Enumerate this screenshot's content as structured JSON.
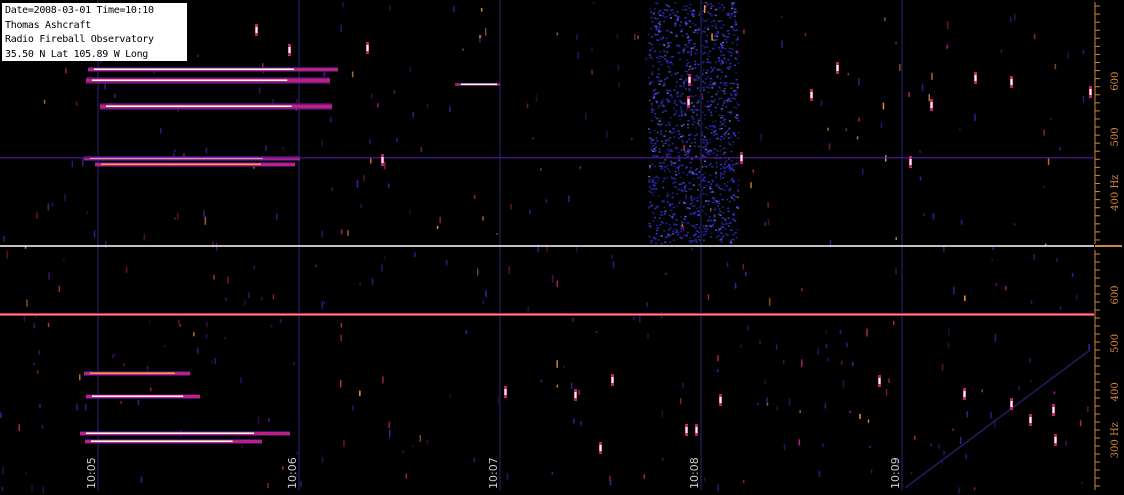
{
  "info": {
    "line1": "Date=2008-03-01 Time=10:10",
    "line2": "Thomas Ashcraft",
    "line3": "Radio Fireball Observatory",
    "line4": "35.50 N Lat  105.89 W Long"
  },
  "time_axis": {
    "labels": [
      "10:05",
      "10:06",
      "10:07",
      "10:08",
      "10:09"
    ]
  },
  "top_panel": {
    "freq_labels": [
      "600",
      "500",
      "400 Hz"
    ],
    "freq_values": [
      600,
      500,
      400
    ]
  },
  "bottom_panel": {
    "freq_labels": [
      "600",
      "500",
      "400",
      "300 Hz"
    ],
    "freq_values": [
      600,
      500,
      400,
      300
    ]
  },
  "colors": {
    "background": "#000000",
    "axis_label": "#d4883a",
    "divider": "#ffffff",
    "noise_band": "#3a3aff",
    "signal_hot": "#ffffe0",
    "signal_warm": "#ff9a3c",
    "signal_mid": "#c0207a",
    "signal_low": "#4a1a9a"
  }
}
